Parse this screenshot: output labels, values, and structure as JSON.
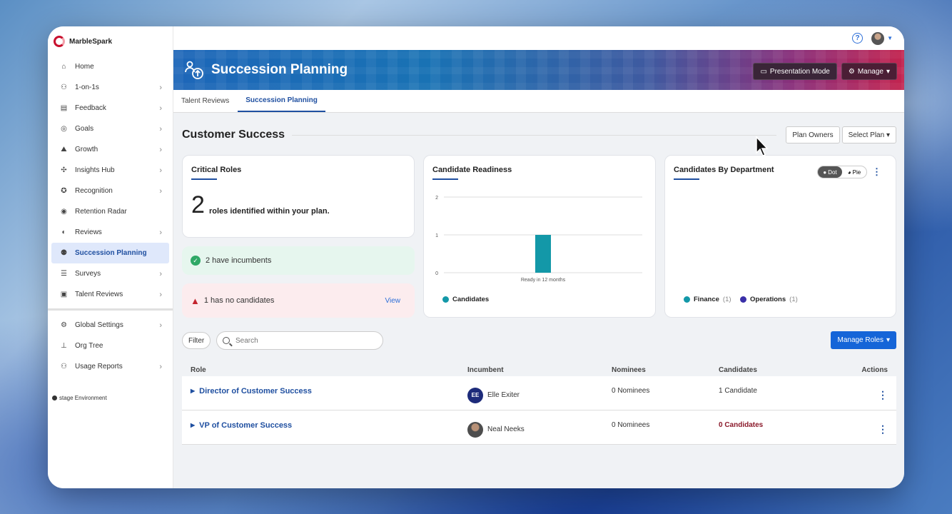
{
  "app": {
    "name": "MarbleSpark"
  },
  "sidebar": {
    "items": [
      {
        "label": "Home",
        "icon": "home-icon",
        "chevron": false
      },
      {
        "label": "1-on-1s",
        "icon": "people-icon",
        "chevron": true
      },
      {
        "label": "Feedback",
        "icon": "feedback-icon",
        "chevron": true
      },
      {
        "label": "Goals",
        "icon": "target-icon",
        "chevron": true
      },
      {
        "label": "Growth",
        "icon": "growth-icon",
        "chevron": true
      },
      {
        "label": "Insights Hub",
        "icon": "network-icon",
        "chevron": true
      },
      {
        "label": "Recognition",
        "icon": "badge-icon",
        "chevron": true
      },
      {
        "label": "Retention Radar",
        "icon": "radar-icon",
        "chevron": false
      },
      {
        "label": "Reviews",
        "icon": "eye-icon",
        "chevron": true
      },
      {
        "label": "Succession Planning",
        "icon": "succession-icon",
        "chevron": false,
        "active": true
      },
      {
        "label": "Surveys",
        "icon": "survey-icon",
        "chevron": true
      },
      {
        "label": "Talent Reviews",
        "icon": "talent-icon",
        "chevron": true
      }
    ],
    "admin_items": [
      {
        "label": "Global Settings",
        "icon": "settings-icon",
        "chevron": true
      },
      {
        "label": "Org Tree",
        "icon": "org-tree-icon",
        "chevron": false
      },
      {
        "label": "Usage Reports",
        "icon": "reports-icon",
        "chevron": true
      }
    ],
    "environment": "stage Environment"
  },
  "banner": {
    "title": "Succession Planning",
    "presentation_label": "Presentation Mode",
    "manage_label": "Manage"
  },
  "tabs": [
    {
      "label": "Talent Reviews"
    },
    {
      "label": "Succession Planning",
      "active": true
    }
  ],
  "section": {
    "title": "Customer Success",
    "plan_owners_label": "Plan Owners",
    "select_plan_label": "Select Plan"
  },
  "critical_roles": {
    "title": "Critical Roles",
    "count": "2",
    "text": "roles identified within your plan.",
    "incumbents_text": "2 have incumbents",
    "no_candidates_text": "1 has no candidates",
    "view_label": "View"
  },
  "readiness": {
    "title": "Candidate Readiness",
    "legend": "Candidates",
    "color": "#1398a8"
  },
  "by_department": {
    "title": "Candidates By Department",
    "toggle_dot": "Dot",
    "toggle_pie": "Pie",
    "legend": [
      {
        "name": "Finance",
        "count": "(1)",
        "color": "#1398a8"
      },
      {
        "name": "Operations",
        "count": "(1)",
        "color": "#3a2fa8"
      }
    ]
  },
  "chart_data": {
    "type": "bar",
    "categories": [
      "Ready in 12 months"
    ],
    "series": [
      {
        "name": "Candidates",
        "values": [
          1
        ]
      }
    ],
    "ylim": [
      0,
      2
    ],
    "yticks": [
      "0",
      "1",
      "2"
    ],
    "grid": true,
    "legend_position": "bottom-left"
  },
  "toolbar": {
    "filter_label": "Filter",
    "search_placeholder": "Search",
    "manage_roles_label": "Manage Roles"
  },
  "table": {
    "headers": {
      "role": "Role",
      "incumbent": "Incumbent",
      "nominees": "Nominees",
      "candidates": "Candidates",
      "actions": "Actions"
    },
    "rows": [
      {
        "role": "Director of Customer Success",
        "incumbent": "Elle Exiter",
        "initials": "EE",
        "nominees": "0 Nominees",
        "candidates": "1 Candidate"
      },
      {
        "role": "VP of Customer Success",
        "incumbent": "Neal Neeks",
        "initials": "",
        "nominees": "0 Nominees",
        "candidates": "0 Candidates"
      }
    ]
  }
}
